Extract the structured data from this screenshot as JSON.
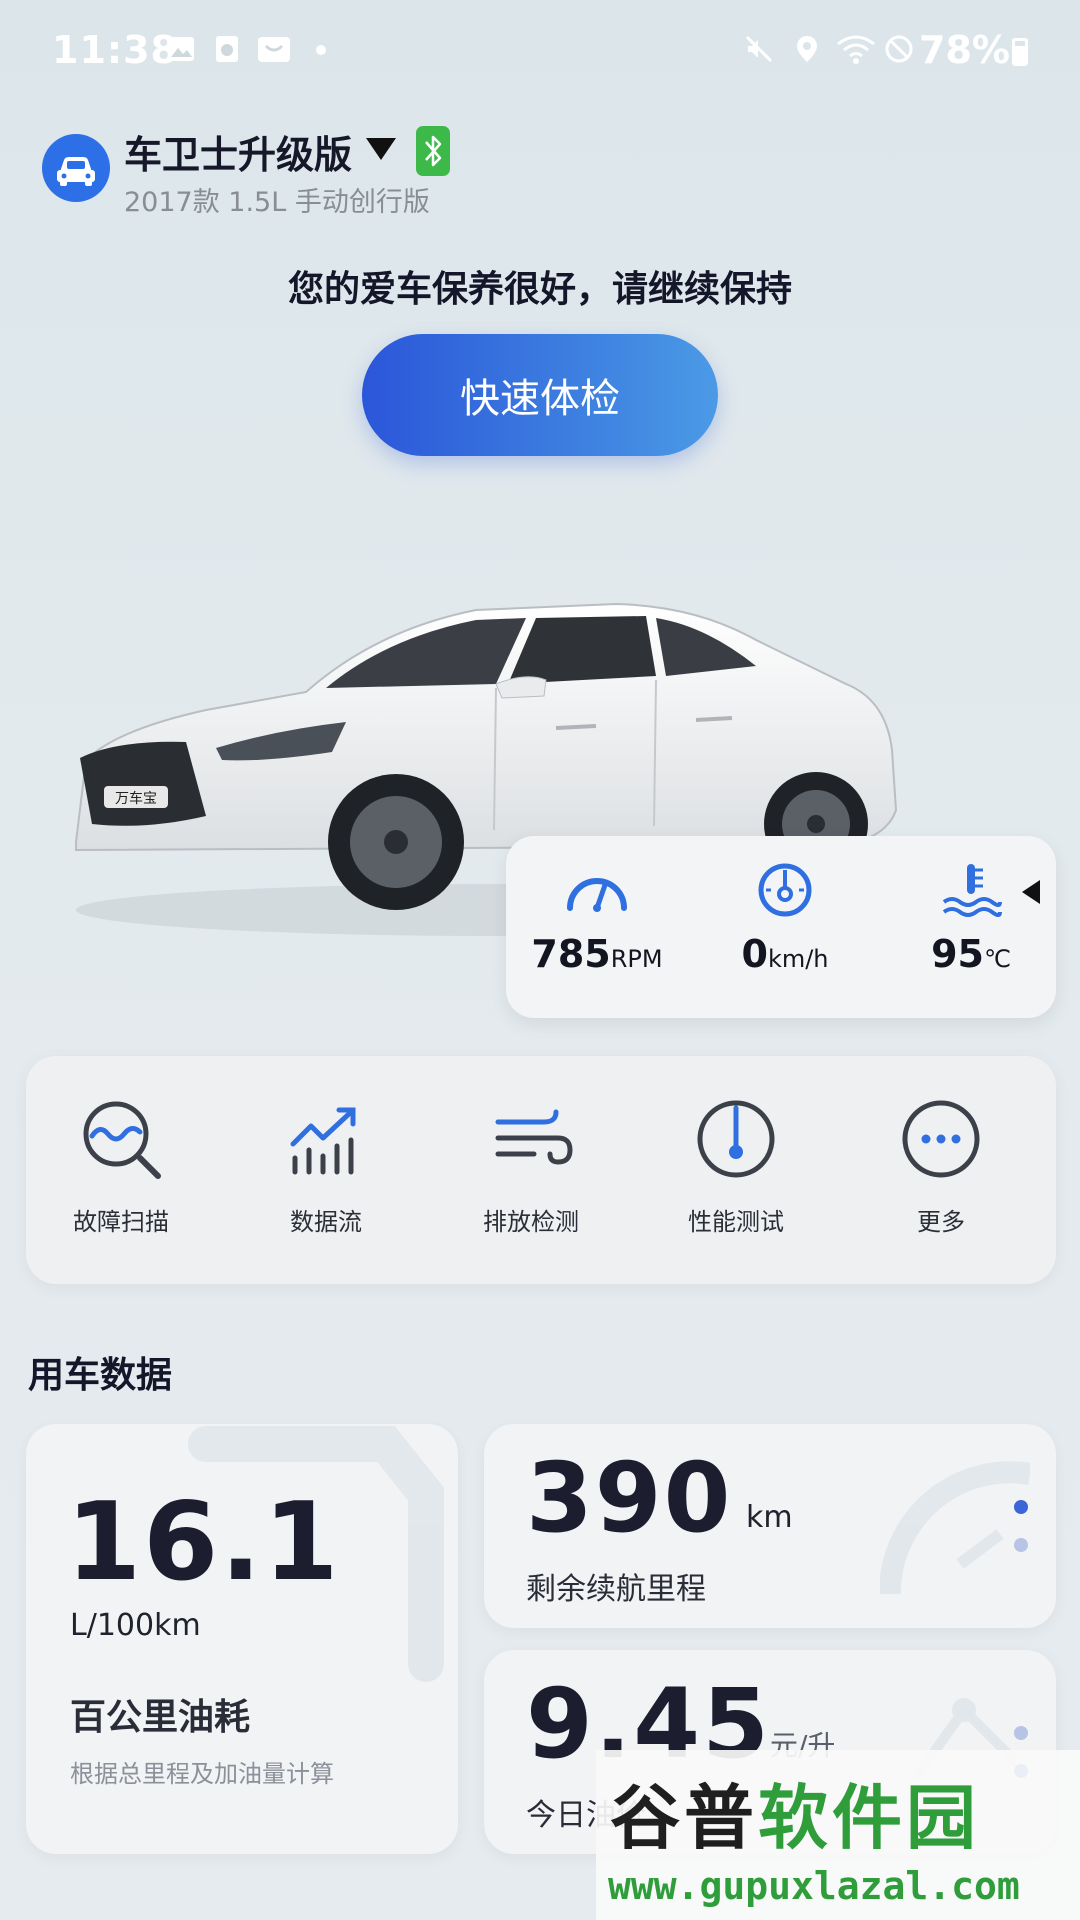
{
  "status_bar": {
    "time": "11:38",
    "battery": "78%"
  },
  "header": {
    "vehicle_name": "车卫士升级版",
    "vehicle_model": "2017款 1.5L 手动创行版"
  },
  "health_message": "您的爱车保养很好，请继续保持",
  "quick_check_label": "快速体检",
  "gauges": [
    {
      "value": "785",
      "unit": "RPM"
    },
    {
      "value": "0",
      "unit": "km/h"
    },
    {
      "value": "95",
      "unit": "℃"
    }
  ],
  "tools": [
    {
      "label": "故障扫描",
      "icon": "diagnostic-scan-icon"
    },
    {
      "label": "数据流",
      "icon": "data-stream-icon"
    },
    {
      "label": "排放检测",
      "icon": "emission-icon"
    },
    {
      "label": "性能测试",
      "icon": "performance-icon"
    },
    {
      "label": "更多",
      "icon": "more-icon"
    }
  ],
  "section_title": "用车数据",
  "fuel": {
    "value": "16.1",
    "unit": "L/100km",
    "title": "百公里油耗",
    "note": "根据总里程及加油量计算"
  },
  "range": {
    "value": "390",
    "unit": "km",
    "label": "剩余续航里程"
  },
  "price": {
    "value": "9.45",
    "unit": "元/升",
    "label": "今日油价"
  },
  "car_badge": "万车宝",
  "watermark": {
    "top_black": "谷普",
    "top_green": "软件园",
    "url": "www.gupuxlazal.com"
  },
  "colors": {
    "accent": "#2c6fe6",
    "button_start": "#2b56d9",
    "button_end": "#4b9ae6",
    "bluetooth": "#3db94a"
  }
}
